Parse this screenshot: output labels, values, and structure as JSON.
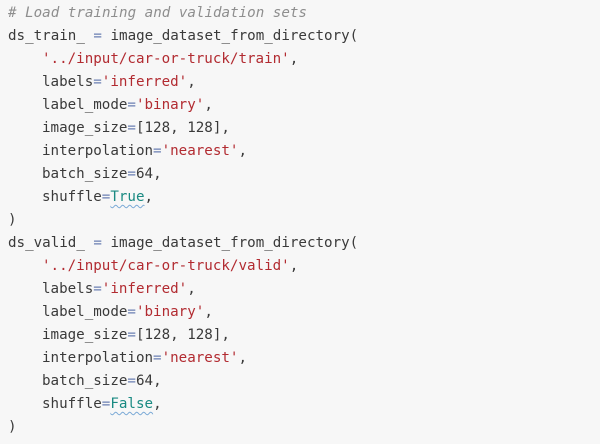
{
  "comment": "# Load training and validation sets",
  "train": {
    "var": "ds_train_",
    "func": "image_dataset_from_directory(",
    "path": "'../input/car-or-truck/train'",
    "labels_key": "labels",
    "labels_val": "'inferred'",
    "label_mode_key": "label_mode",
    "label_mode_val": "'binary'",
    "image_size_key": "image_size",
    "image_size_val": "[128, 128]",
    "interpolation_key": "interpolation",
    "interpolation_val": "'nearest'",
    "batch_size_key": "batch_size",
    "batch_size_val": "64",
    "shuffle_key": "shuffle",
    "shuffle_val": "True",
    "close": ")"
  },
  "valid": {
    "var": "ds_valid_",
    "func": "image_dataset_from_directory(",
    "path": "'../input/car-or-truck/valid'",
    "labels_key": "labels",
    "labels_val": "'inferred'",
    "label_mode_key": "label_mode",
    "label_mode_val": "'binary'",
    "image_size_key": "image_size",
    "image_size_val": "[128, 128]",
    "interpolation_key": "interpolation",
    "interpolation_val": "'nearest'",
    "batch_size_key": "batch_size",
    "batch_size_val": "64",
    "shuffle_key": "shuffle",
    "shuffle_val": "False",
    "close": ")"
  }
}
